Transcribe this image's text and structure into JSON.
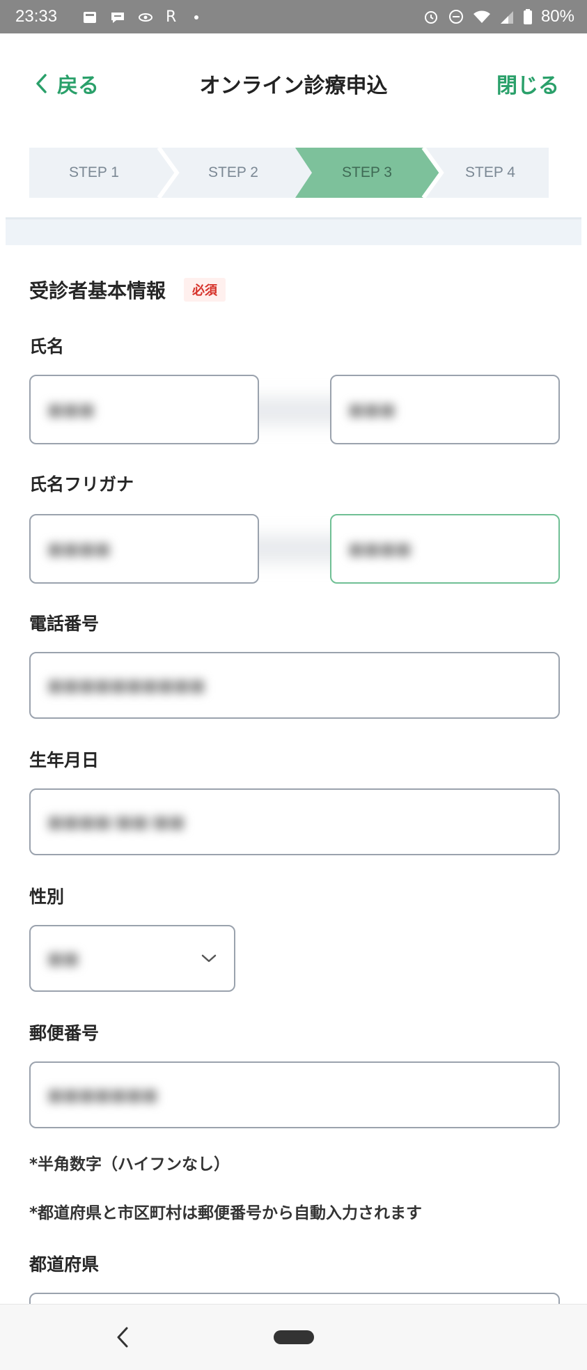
{
  "status_bar": {
    "time": "23:33",
    "left_icons": [
      "gallery-icon",
      "chat-icon",
      "eye-icon",
      "r-letter",
      "dot-icon"
    ],
    "right_icons": [
      "alarm-icon",
      "dnd-icon",
      "wifi-icon",
      "signal-icon",
      "battery-icon"
    ],
    "r_letter": "R",
    "battery_percent": "80%"
  },
  "nav": {
    "back_label": "戻る",
    "title": "オンライン診療申込",
    "close_label": "閉じる"
  },
  "stepper": {
    "steps": [
      {
        "label": "STEP 1",
        "active": false
      },
      {
        "label": "STEP 2",
        "active": false
      },
      {
        "label": "STEP 3",
        "active": true
      },
      {
        "label": "STEP 4",
        "active": false
      }
    ],
    "active_color": "#7dc19b"
  },
  "form": {
    "section_title": "受診者基本情報",
    "required_badge": "必須",
    "name_label": "氏名",
    "kana_label": "氏名フリガナ",
    "phone_label": "電話番号",
    "birthday_label": "生年月日",
    "gender_label": "性別",
    "postal_label": "郵便番号",
    "postal_note1": "*半角数字（ハイフンなし）",
    "postal_note2": "*都道府県と市区町村は郵便番号から自動入力されます",
    "prefecture_label": "都道府県"
  },
  "colors": {
    "accent": "#2aa06a",
    "required": "#d6322a",
    "field_border": "#9aa2ad",
    "focused_border": "#6fbf94"
  }
}
